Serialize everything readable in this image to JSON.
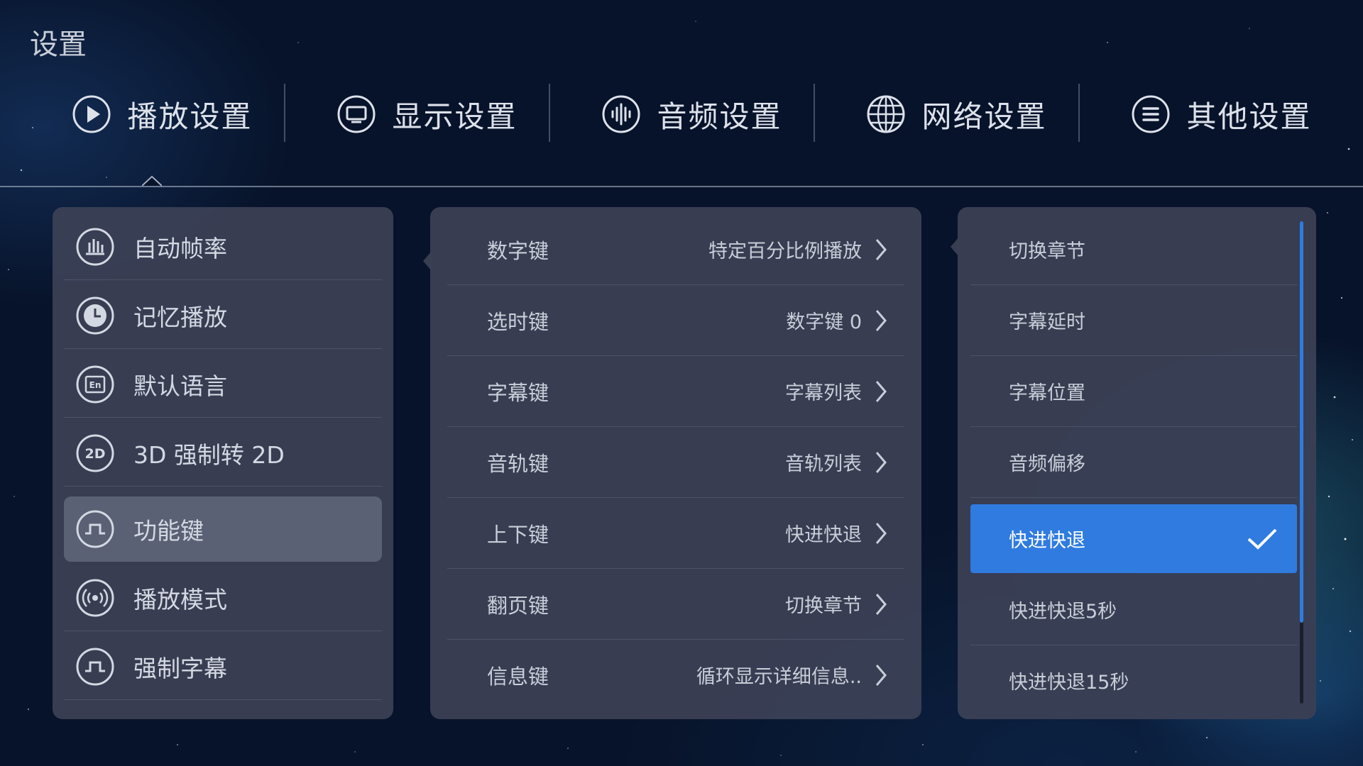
{
  "page_title": "设置",
  "tabs": [
    {
      "label": "播放设置",
      "icon": "play-circle-icon"
    },
    {
      "label": "显示设置",
      "icon": "monitor-icon"
    },
    {
      "label": "音频设置",
      "icon": "audio-wave-icon"
    },
    {
      "label": "网络设置",
      "icon": "globe-icon"
    },
    {
      "label": "其他设置",
      "icon": "menu-list-icon"
    }
  ],
  "active_tab": "播放设置",
  "left_menu": [
    {
      "label": "自动帧率",
      "icon": "bar-chart-icon"
    },
    {
      "label": "记忆播放",
      "icon": "clock-icon"
    },
    {
      "label": "默认语言",
      "icon": "language-icon"
    },
    {
      "label": "3D 强制转 2D",
      "icon": "2d-icon"
    },
    {
      "label": "功能键",
      "icon": "pulse-key-icon"
    },
    {
      "label": "播放模式",
      "icon": "broadcast-icon"
    },
    {
      "label": "强制字幕",
      "icon": "pulse-key-icon"
    }
  ],
  "left_selected": "功能键",
  "function_keys": [
    {
      "label": "数字键",
      "value": "特定百分比例播放"
    },
    {
      "label": "选时键",
      "value": "数字键 0"
    },
    {
      "label": "字幕键",
      "value": "字幕列表"
    },
    {
      "label": "音轨键",
      "value": "音轨列表"
    },
    {
      "label": "上下键",
      "value": "快进快退"
    },
    {
      "label": "翻页键",
      "value": "切换章节"
    },
    {
      "label": "信息键",
      "value": "循环显示详细信息.."
    }
  ],
  "options": [
    {
      "label": "切换章节"
    },
    {
      "label": "字幕延时"
    },
    {
      "label": "字幕位置"
    },
    {
      "label": "音频偏移"
    },
    {
      "label": "快进快退"
    },
    {
      "label": "快进快退5秒"
    },
    {
      "label": "快进快退15秒"
    }
  ],
  "option_selected": "快进快退",
  "colors": {
    "background": "#07132a",
    "panel": "#3a4054",
    "selected_left": "#5a6174",
    "accent": "#2f7be0",
    "text": "#d4d8e2"
  }
}
